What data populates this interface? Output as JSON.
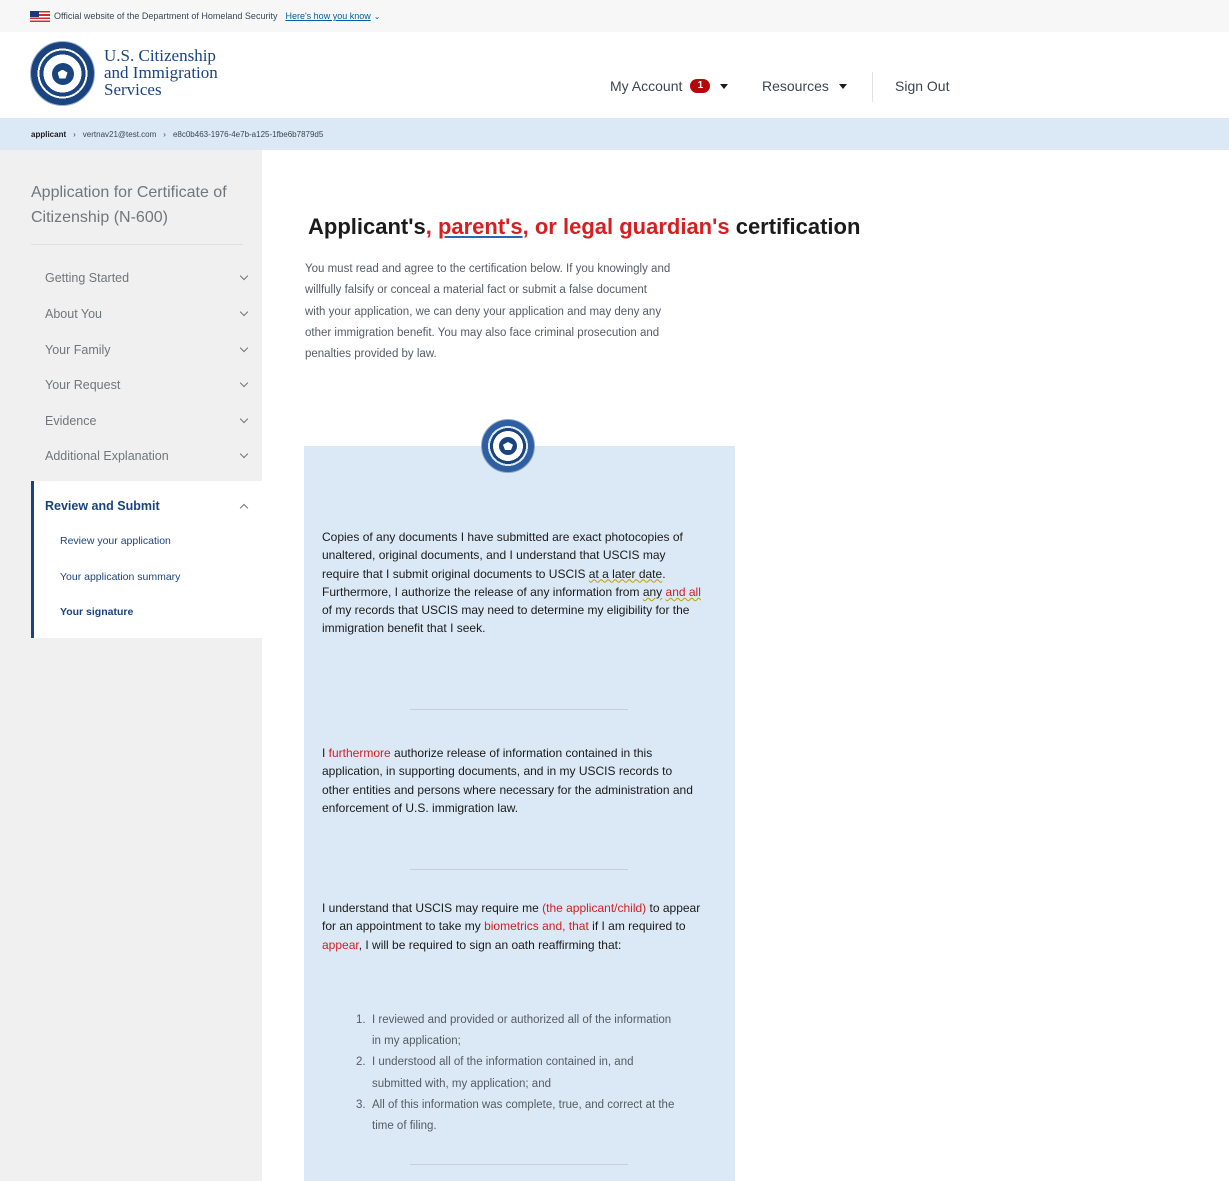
{
  "gov_banner": {
    "text": "Official website of the Department of Homeland Security",
    "link": "Here's how you know"
  },
  "header": {
    "agency_line1": "U.S. Citizenship",
    "agency_line2": "and Immigration",
    "agency_line3": "Services",
    "nav": {
      "my_account": "My Account",
      "my_account_badge": "1",
      "resources": "Resources",
      "sign_out": "Sign Out"
    }
  },
  "breadcrumb": [
    "applicant",
    "vertnav21@test.com",
    "e8c0b463-1976-4e7b-a125-1fbe6b7879d5"
  ],
  "sidebar": {
    "title": "Application for Certificate of Citizenship (N-600)",
    "items": [
      {
        "label": "Getting Started"
      },
      {
        "label": "About You"
      },
      {
        "label": "Your Family"
      },
      {
        "label": "Your Request"
      },
      {
        "label": "Evidence"
      },
      {
        "label": "Additional Explanation"
      }
    ],
    "active": {
      "label": "Review and Submit",
      "subitems": [
        {
          "label": "Review your application"
        },
        {
          "label": "Your application summary"
        },
        {
          "label": "Your signature"
        }
      ]
    }
  },
  "main": {
    "title_part1": "Applicant's",
    "title_part2": ", parent's",
    "title_part3": ", or legal guardian's",
    "title_part4": " certification",
    "intro_line1": "You must read and agree to the certification below. If you knowingly and",
    "intro_line2": "willfully falsify or conceal a material fact or submit a false document",
    "intro_line3": "with your application, we can deny your application and may deny any",
    "intro_line4": "other immigration benefit. You may also face criminal prosecution and",
    "intro_line5": "penalties provided by law.",
    "cert1_a": "Copies of any documents I have submitted are exact photocopies of unaltered, original documents, and I understand that USCIS may require that I submit original documents to USCIS ",
    "cert1_b": "at a later date",
    "cert1_c": ".  Furthermore, I authorize the release of any information from ",
    "cert1_d": "any",
    "cert1_e": " ",
    "cert1_f": "and all",
    "cert1_g": " of my records that USCIS may need to determine my eligibility for the immigration benefit that I seek.",
    "cert2_a": "I ",
    "cert2_b": "furthermore",
    "cert2_c": " authorize release of information contained in this application, in supporting documents, and in my USCIS records to other entities and persons where necessary for the administration and enforcement of U.S. immigration law.",
    "cert3_a": "I understand that USCIS may require me ",
    "cert3_b": "(the applicant/child)",
    "cert3_c": " to appear for an appointment to take my ",
    "cert3_d": "biometrics and, that",
    "cert3_e": " if I am required to ",
    "cert3_f": "appear",
    "cert3_g": ", I will be required to sign an oath reaffirming that:",
    "oath": [
      {
        "num": "1.",
        "text": "I reviewed and provided or authorized all of the information in my application;"
      },
      {
        "num": "2.",
        "text": "I understood all of the information contained in, and submitted with, my application; and"
      },
      {
        "num": "3.",
        "text": "All of this information was complete, true, and correct at the time of filing."
      }
    ]
  }
}
